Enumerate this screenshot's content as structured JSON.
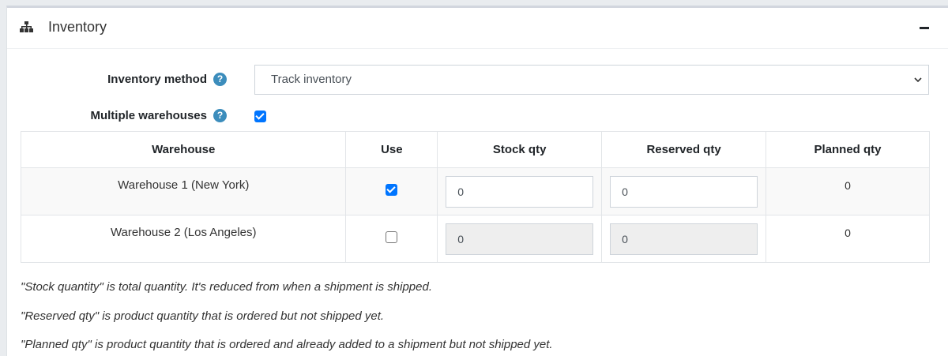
{
  "panel": {
    "title": "Inventory",
    "icon": "sitemap-icon",
    "collapse_icon": "minus-icon"
  },
  "inventory_method": {
    "label": "Inventory method",
    "help": "?",
    "selected": "Track inventory"
  },
  "multiple_warehouses": {
    "label": "Multiple warehouses",
    "help": "?",
    "checked": true
  },
  "table": {
    "headers": [
      "Warehouse",
      "Use",
      "Stock qty",
      "Reserved qty",
      "Planned qty"
    ],
    "rows": [
      {
        "warehouse": "Warehouse 1 (New York)",
        "use": true,
        "stock_qty": "0",
        "reserved_qty": "0",
        "planned_qty": "0",
        "editable": true
      },
      {
        "warehouse": "Warehouse 2 (Los Angeles)",
        "use": false,
        "stock_qty": "0",
        "reserved_qty": "0",
        "planned_qty": "0",
        "editable": false
      }
    ]
  },
  "notes": [
    "\"Stock quantity\" is total quantity. It's reduced from when a shipment is shipped.",
    "\"Reserved qty\" is product quantity that is ordered but not shipped yet.",
    "\"Planned qty\" is product quantity that is ordered and already added to a shipment but not shipped yet."
  ],
  "colors": {
    "accent": "#3c8dbc",
    "checkbox": "#0075ff"
  }
}
